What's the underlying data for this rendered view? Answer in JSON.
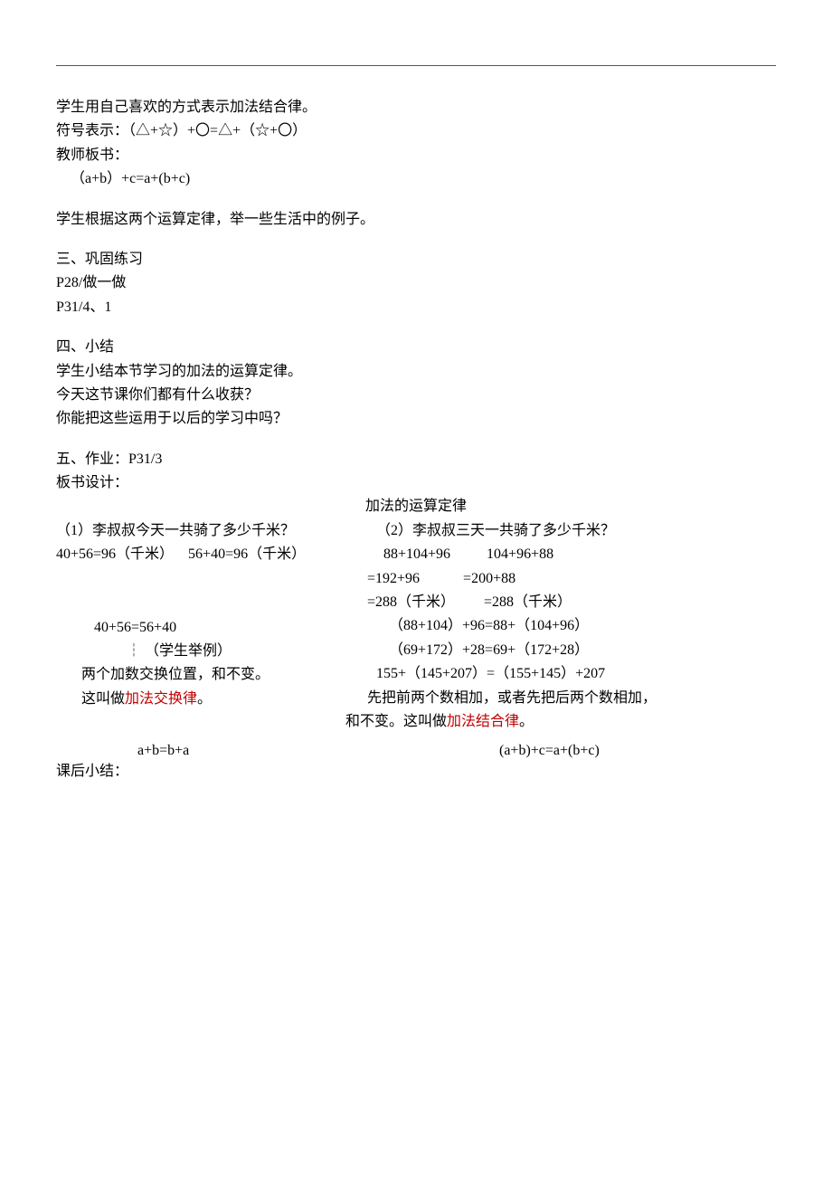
{
  "intro": {
    "l1": "学生用自己喜欢的方式表示加法结合律。",
    "l2": "符号表示：（△+☆）+〇=△+（☆+〇）",
    "l3": "教师板书：",
    "l4": "（a+b）+c=a+(b+c)",
    "l5": "学生根据这两个运算定律，举一些生活中的例子。"
  },
  "s3": {
    "head": "三、巩固练习",
    "l1": "P28/做一做",
    "l2": "P31/4、1"
  },
  "s4": {
    "head": "四、小结",
    "l1": "学生小结本节学习的加法的运算定律。",
    "l2": "今天这节课你们都有什么收获？",
    "l3": "你能把这些运用于以后的学习中吗？"
  },
  "s5": {
    "head": "五、作业：P31/3",
    "l1": "板书设计："
  },
  "board": {
    "title": "加法的运算定律",
    "left": {
      "q": "（1）李叔叔今天一共骑了多少千米？",
      "calc": "40+56=96（千米）    56+40=96（千米）",
      "eq": "40+56=56+40",
      "dash": "┆ （学生举例）",
      "rule_pre": "两个加数交换位置，和不变。",
      "rule_text_a": "这叫做",
      "rule_red": "加法交换律",
      "rule_text_b": "。",
      "formula": "a+b=b+a"
    },
    "right": {
      "q": "（2）李叔叔三天一共骑了多少千米？",
      "r1": "  88+104+96          104+96+88",
      "r2": " =192+96            =200+88",
      "r3": " =288（千米）        =288（千米）",
      "r4": "（88+104）+96=88+（104+96）",
      "r5": "（69+172）+28=69+（172+28）",
      "r6": "155+（145+207）=（155+145）+207",
      "rule_a": "先把前两个数相加，或者先把后两个数相加，",
      "rule_b1": "和不变。这叫做",
      "rule_red": "加法结合律",
      "rule_b2": "。",
      "formula": "(a+b)+c=a+(b+c)"
    }
  },
  "after": "课后小结："
}
